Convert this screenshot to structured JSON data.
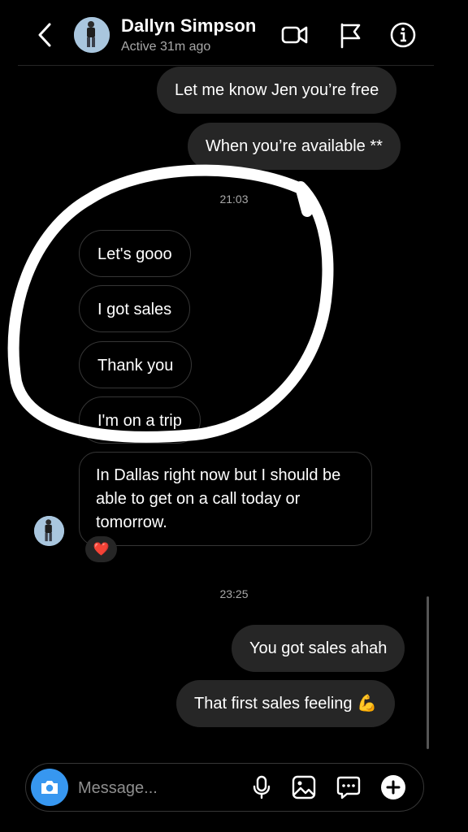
{
  "header": {
    "name": "Dallyn Simpson",
    "status": "Active 31m ago",
    "icons": [
      "back-icon",
      "video-call-icon",
      "flag-icon",
      "info-icon"
    ]
  },
  "messages": {
    "sent_top": [
      "Let me know Jen you’re free",
      "When you’re available **"
    ],
    "time_1": "21:03",
    "received": [
      "Let's gooo",
      "I got sales",
      "Thank you",
      "I'm on a trip"
    ],
    "received_long": "In Dallas right now but I should be able to get on a call today or tomorrow.",
    "reaction": "❤️",
    "time_2": "23:25",
    "sent_bottom": [
      "You got sales ahah",
      "That first sales feeling 💪"
    ]
  },
  "composer": {
    "placeholder": "Message...",
    "icons": [
      "camera-icon",
      "microphone-icon",
      "gallery-icon",
      "sticker-icon",
      "plus-icon"
    ]
  },
  "colors": {
    "accent": "#3797f0",
    "bubble_out": "#262626",
    "border_in": "#363636",
    "muted": "#a8a8a8"
  }
}
